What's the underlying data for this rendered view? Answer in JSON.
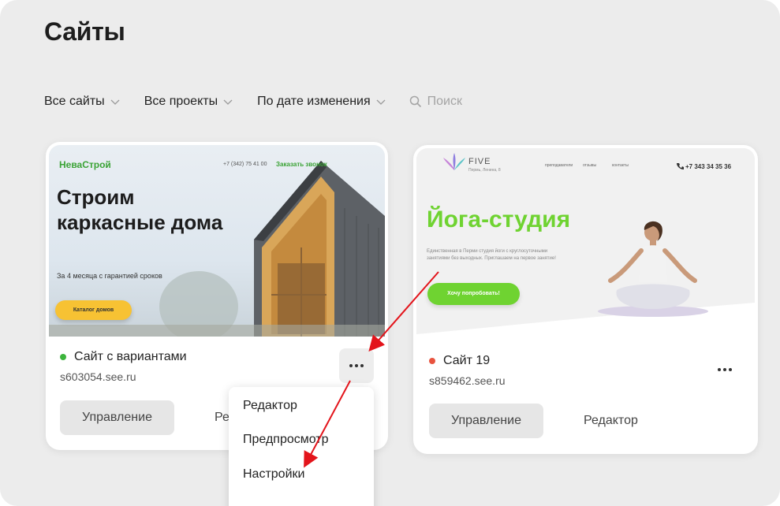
{
  "page": {
    "title": "Сайты"
  },
  "filters": {
    "all_sites": "Все сайты",
    "all_projects": "Все проекты",
    "sort": "По дате изменения",
    "search_placeholder": "Поиск"
  },
  "cards": [
    {
      "name": "Сайт с вариантами",
      "domain": "s603054.see.ru",
      "status_color": "#3cb43c",
      "manage_label": "Управление",
      "editor_label": "Ре",
      "preview": {
        "brand": "НеваСтрой",
        "phone": "+7 (342) 75 41 00",
        "call": "Заказать звонок",
        "headline": "Строим каркасные дома",
        "subtitle": "За 4 месяца с гарантией сроков",
        "button": "Каталог домов"
      }
    },
    {
      "name": "Сайт 19",
      "domain": "s859462.see.ru",
      "status_color": "#e8533e",
      "manage_label": "Управление",
      "editor_label": "Редактор",
      "preview": {
        "brand": "FIVE",
        "brand_sub": "Пермь, Ленина, 8",
        "nav": [
          "преподаватели",
          "отзывы",
          "контакты"
        ],
        "phone": "+7 343 34 35 36",
        "headline": "Йога-студия",
        "description": "Единственная в Перми студия йоги с круглосуточными занятиями без выходных. Приглашаем на первое занятие!",
        "button": "Хочу попробовать!"
      }
    }
  ],
  "context_menu": {
    "items": [
      "Редактор",
      "Предпросмотр",
      "Настройки"
    ]
  },
  "colors": {
    "background": "#ececec",
    "annotation_arrow": "#e3141b",
    "accent_green": "#6fd331"
  }
}
